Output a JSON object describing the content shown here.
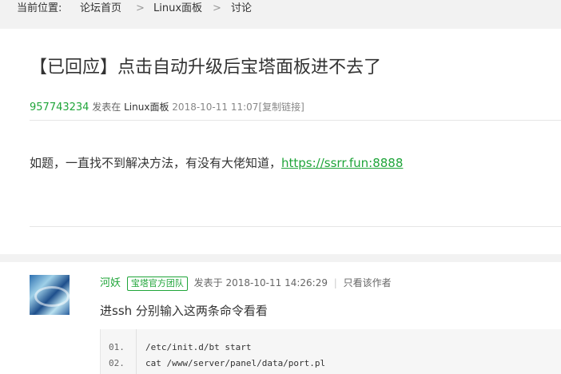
{
  "breadcrumb": {
    "label": "当前位置:",
    "items": [
      "论坛首页",
      "Linux面板",
      "讨论"
    ],
    "separator": ">"
  },
  "post": {
    "title": "【已回应】点击自动升级后宝塔面板进不去了",
    "author": "957743234",
    "posted_in": "发表在",
    "forum": "Linux面板",
    "time": "2018-10-11 11:07",
    "copy_link": "[复制链接]",
    "content_text": "如题，一直找不到解决方法，有没有大佬知道，",
    "content_link": "https://ssrr.fun:8888"
  },
  "reply": {
    "author": "河妖",
    "badge": "宝塔官方团队",
    "posted_at_label": "发表于",
    "time": "2018-10-11 14:26:29",
    "separator": "|",
    "only_author": "只看该作者",
    "content": "进ssh 分别输入这两条命令看看",
    "code_lines": [
      {
        "num": "01.",
        "text": "/etc/init.d/bt start"
      },
      {
        "num": "02.",
        "text": "cat /www/server/panel/data/port.pl"
      }
    ]
  },
  "colors": {
    "accent": "#20a53a",
    "background": "#f2f2f2"
  }
}
